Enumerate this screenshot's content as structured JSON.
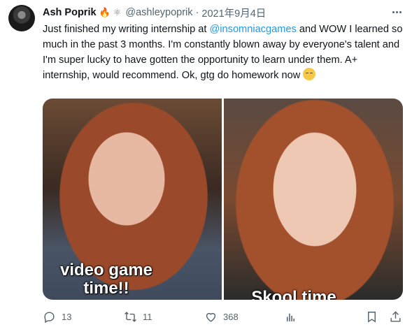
{
  "tweet": {
    "author_name": "Ash Poprik",
    "author_emoji_1": "🔥",
    "author_emoji_2": "⚛",
    "handle": "@ashleypoprik",
    "separator": "·",
    "date": "2021年9月4日",
    "text_part1": "Just finished my writing internship at ",
    "mention": "@insomniacgames",
    "text_part2": " and WOW I learned so much in the past 3 months. I'm constantly blown away by everyone's talent and I'm super lucky to have gotten the opportunity to learn under them. A+ internship, would recommend. Ok, gtg do homework now ",
    "trailing_emoji": "pensive-face"
  },
  "media": {
    "left_caption": "video game\ntime!!",
    "right_caption": "Skool time"
  },
  "actions": {
    "reply_count": "13",
    "retweet_count": "11",
    "like_count": "368"
  },
  "colors": {
    "text": "#0f1419",
    "secondary": "#536471",
    "link": "#1d9bf0"
  }
}
